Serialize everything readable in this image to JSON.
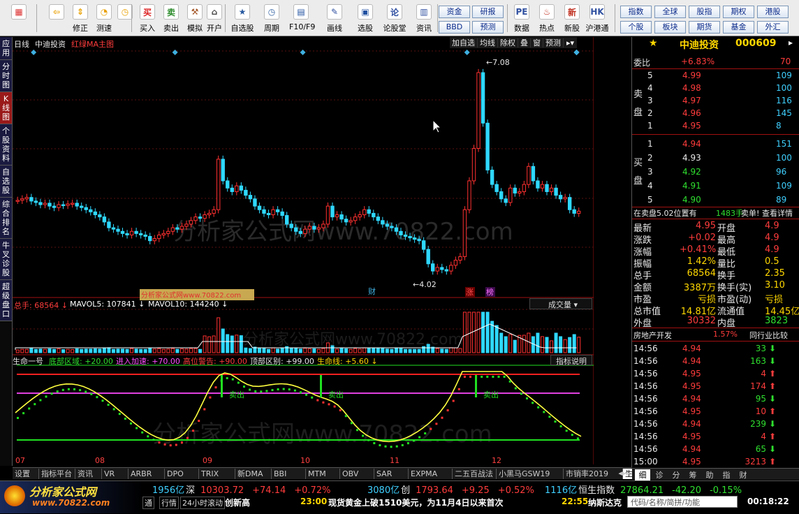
{
  "toolbar": {
    "buttons": [
      {
        "label": "",
        "icon": "layout-icon"
      },
      {
        "label": "",
        "icon": "back-arrow-icon"
      },
      {
        "label": "修正",
        "icon": "up-down-arrows-icon"
      },
      {
        "label": "测速",
        "icon": "speed-icon"
      },
      {
        "label": "",
        "icon": "clock-icon"
      },
      {
        "label": "买入",
        "icon": "buy-icon"
      },
      {
        "label": "卖出",
        "icon": "sell-icon"
      },
      {
        "label": "模拟",
        "icon": "hammer-icon"
      },
      {
        "label": "开户",
        "icon": "open-account-icon"
      },
      {
        "label": "自选股",
        "icon": "star-list-icon"
      },
      {
        "label": "周期",
        "icon": "period-icon"
      },
      {
        "label": "F10/F9",
        "icon": "f10-icon"
      },
      {
        "label": "画线",
        "icon": "pen-icon"
      },
      {
        "label": "选股",
        "icon": "select-stock-icon"
      },
      {
        "label": "论股堂",
        "icon": "forum-icon"
      },
      {
        "label": "资讯",
        "icon": "news-icon"
      },
      {
        "label": "数据",
        "icon": "pe-icon"
      },
      {
        "label": "热点",
        "icon": "hot-icon"
      },
      {
        "label": "新股",
        "icon": "new-stock-icon"
      },
      {
        "label": "沪港通",
        "icon": "hk-connect-icon"
      }
    ],
    "quick_left": [
      "资金",
      "研报",
      "BBD",
      "预测"
    ],
    "quick_right": [
      "指数",
      "全球",
      "股指",
      "期权",
      "港股",
      "个股",
      "板块",
      "期货",
      "基金",
      "外汇"
    ]
  },
  "side_tabs": [
    "应用",
    "分时图",
    "K线图",
    "个股资料",
    "自选股",
    "综合排名",
    "牛叉诊股",
    "超级盘口"
  ],
  "header": {
    "period": "日线",
    "stock_name": "中迪投资",
    "indicator": "红绿MA主图",
    "tools": [
      "加自选",
      "均线",
      "除权",
      "叠",
      "窗",
      "预测"
    ]
  },
  "price_axis": [
    "7.25",
    "6.58",
    "5.89",
    "5.22",
    "4.53"
  ],
  "annotations": {
    "high": "7.08",
    "low": "4.02",
    "fin": "财",
    "up": "涨",
    "list": "榜"
  },
  "volume": {
    "label": "总手: 68564",
    "mavol5": "MAVOL5: 107841",
    "mavol10": "MAVOL10: 144240",
    "dropdown": "成交量",
    "axis": [
      "63006",
      "32037",
      "X10"
    ]
  },
  "indicator": {
    "name": "生命一号",
    "bottom_zone": "底部区域: +20.00",
    "accelerate": "进入加速: +70.00",
    "high_warn": "高位警告: +90.00",
    "top_zone": "顶部区别: +99.00",
    "life_line": "生命线: +5.60",
    "help": "指标说明",
    "axis": [
      "+99.00",
      "+67.87",
      "+36.73"
    ],
    "sell_label": "卖出"
  },
  "watermark": "分析家公式网www.70822.com",
  "watermark_small": "分析家公式网www.70822.com",
  "months": [
    "07",
    "08",
    "09",
    "10",
    "11",
    "12"
  ],
  "tabs": [
    "设置",
    "指标平台",
    "资讯",
    "VR",
    "ARBR",
    "DPO",
    "TRIX",
    "新DMA",
    "BBI",
    "MTM",
    "OBV",
    "SAR",
    "EXPMA",
    "二五百战法",
    "小黑马GSW19",
    "市销率2019",
    "生命一号"
  ],
  "right": {
    "name": "中迪投资",
    "code": "000609",
    "weibi_label": "委比",
    "weibi": "+6.83%",
    "weibi_v": "70",
    "sell_label": "卖盘",
    "buy_label": "买盘",
    "asks": [
      [
        "5",
        "4.99",
        "109"
      ],
      [
        "4",
        "4.98",
        "100"
      ],
      [
        "3",
        "4.97",
        "116"
      ],
      [
        "2",
        "4.96",
        "145"
      ],
      [
        "1",
        "4.95",
        "8"
      ]
    ],
    "bids": [
      [
        "1",
        "4.94",
        "151"
      ],
      [
        "2",
        "4.93",
        "100"
      ],
      [
        "3",
        "4.92",
        "96"
      ],
      [
        "4",
        "4.91",
        "109"
      ],
      [
        "5",
        "4.90",
        "89"
      ]
    ],
    "notice": "在卖盘5.02位置有",
    "notice_v": "1483手",
    "notice_r": "卖单!",
    "notice_link": "查看详情",
    "stats": [
      [
        "最新",
        "4.95",
        "开盘",
        "4.9"
      ],
      [
        "涨跌",
        "+0.02",
        "最高",
        "4.9"
      ],
      [
        "涨幅",
        "+0.41%",
        "最低",
        "4.9"
      ],
      [
        "振幅",
        "1.42%",
        "量比",
        "0.5"
      ],
      [
        "总手",
        "68564",
        "换手",
        "2.35"
      ],
      [
        "金额",
        "3387万",
        "换手(实)",
        "3.10"
      ],
      [
        "市盈",
        "亏损",
        "市盈(动)",
        "亏损"
      ],
      [
        "总市值",
        "14.81亿",
        "流通值",
        "14.45亿"
      ],
      [
        "外盘",
        "30332",
        "内盘",
        "3823"
      ]
    ],
    "sector": "房地产开发",
    "sector_chg": "1.57%",
    "sector_link": "同行业比较",
    "trades": [
      [
        "14:56",
        "4.94",
        "33",
        "d"
      ],
      [
        "14:56",
        "4.94",
        "163",
        "d"
      ],
      [
        "14:56",
        "4.95",
        "4",
        "u"
      ],
      [
        "14:56",
        "4.95",
        "174",
        "u"
      ],
      [
        "14:56",
        "4.94",
        "95",
        "d"
      ],
      [
        "14:56",
        "4.95",
        "10",
        "u"
      ],
      [
        "14:56",
        "4.94",
        "239",
        "d"
      ],
      [
        "14:56",
        "4.95",
        "4",
        "u"
      ],
      [
        "14:56",
        "4.94",
        "65",
        "d"
      ],
      [
        "15:00",
        "4.95",
        "3213",
        "u"
      ]
    ],
    "bottom_tabs": [
      "细",
      "诊",
      "分",
      "筹",
      "助",
      "指",
      "财"
    ]
  },
  "bottom": {
    "logo": "分析家公式网",
    "logo_url": "www.70822.com",
    "row1": [
      [
        "1956亿",
        "深",
        "10303.72",
        "+74.14",
        "+0.72%"
      ],
      [
        "3080亿",
        "创",
        "1793.64",
        "+9.25",
        "+0.52%"
      ],
      [
        "1116亿",
        "恒生指数",
        "27864.21",
        "-42.20",
        "-0.15%"
      ]
    ],
    "row2_left": [
      "通",
      "行情",
      "24小时滚动"
    ],
    "news1": "创新高",
    "news_time": "23:00",
    "news2": "现货黄金上破1510美元，为11月4日以来首次",
    "news_time2": "22:55",
    "news3": "纳斯达克",
    "search": "代码/名称/简拼/功能",
    "clock": "00:18:22"
  }
}
